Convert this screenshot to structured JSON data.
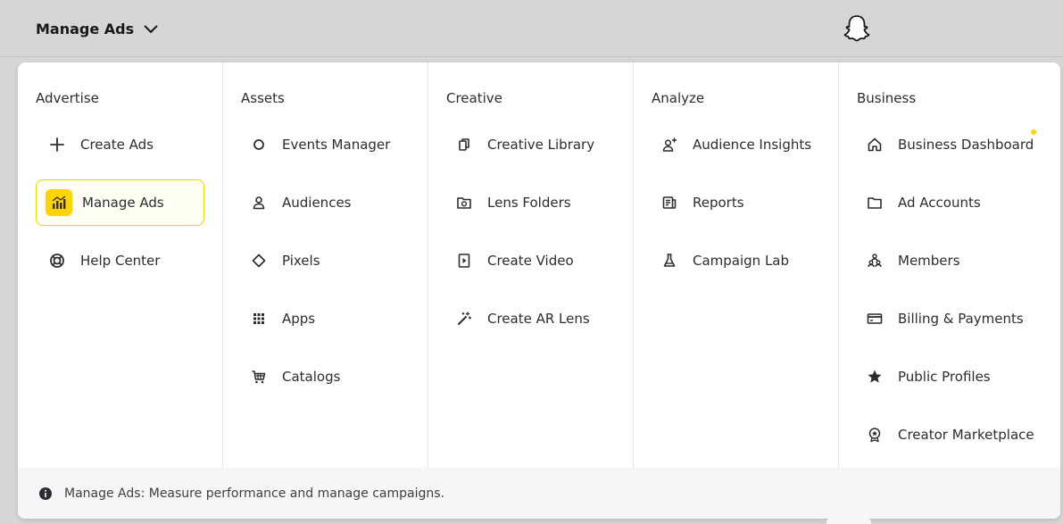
{
  "topbar": {
    "title": "Manage Ads",
    "logo_icon": "snapchat-ghost-icon"
  },
  "columns": [
    {
      "key": "advertise",
      "title": "Advertise",
      "items": [
        {
          "label": "Create Ads",
          "icon": "plus-icon"
        },
        {
          "label": "Manage Ads",
          "icon": "bar-chart-icon",
          "active": true
        },
        {
          "label": "Help Center",
          "icon": "lifebuoy-icon"
        }
      ]
    },
    {
      "key": "assets",
      "title": "Assets",
      "items": [
        {
          "label": "Events Manager",
          "icon": "circle-icon"
        },
        {
          "label": "Audiences",
          "icon": "person-icon"
        },
        {
          "label": "Pixels",
          "icon": "diamond-icon"
        },
        {
          "label": "Apps",
          "icon": "grid-icon"
        },
        {
          "label": "Catalogs",
          "icon": "cart-icon"
        }
      ]
    },
    {
      "key": "creative",
      "title": "Creative",
      "items": [
        {
          "label": "Creative Library",
          "icon": "copy-icon"
        },
        {
          "label": "Lens Folders",
          "icon": "camera-folder-icon"
        },
        {
          "label": "Create Video",
          "icon": "play-file-icon"
        },
        {
          "label": "Create AR Lens",
          "icon": "magic-wand-icon"
        }
      ]
    },
    {
      "key": "analyze",
      "title": "Analyze",
      "items": [
        {
          "label": "Audience Insights",
          "icon": "person-sparkle-icon"
        },
        {
          "label": "Reports",
          "icon": "report-icon"
        },
        {
          "label": "Campaign Lab",
          "icon": "flask-icon"
        }
      ]
    },
    {
      "key": "business",
      "title": "Business",
      "items": [
        {
          "label": "Business Dashboard",
          "icon": "home-icon"
        },
        {
          "label": "Ad Accounts",
          "icon": "folder-icon"
        },
        {
          "label": "Members",
          "icon": "members-icon"
        },
        {
          "label": "Billing & Payments",
          "icon": "credit-card-icon"
        },
        {
          "label": "Public Profiles",
          "icon": "star-icon"
        },
        {
          "label": "Creator Marketplace",
          "icon": "badge-icon"
        }
      ]
    }
  ],
  "footer": {
    "text": "Manage Ads: Measure performance and manage campaigns.",
    "icon": "info-icon"
  },
  "colors": {
    "accent": "#ffd400",
    "active_border": "#f2d600",
    "text": "#2a2d31",
    "background_dim": "#d6d6d6",
    "footer_bg": "#f5f6f7"
  }
}
